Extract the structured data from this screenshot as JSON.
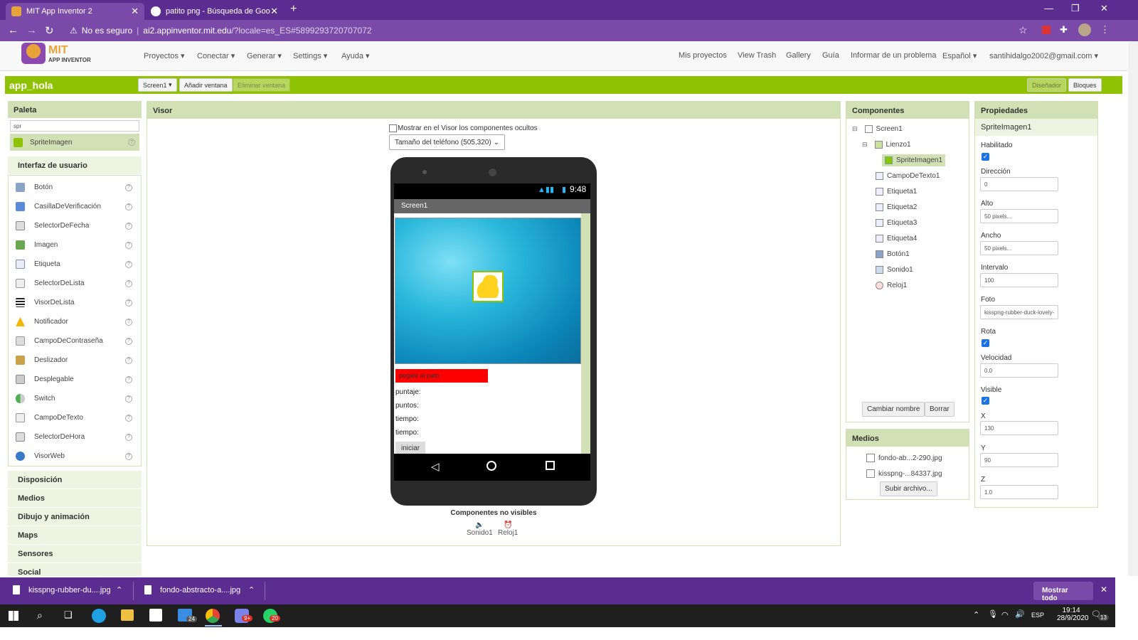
{
  "browser": {
    "tabs": [
      {
        "title": "MIT App Inventor 2"
      },
      {
        "title": "patito png - Búsqueda de Googl"
      }
    ],
    "security": "No es seguro",
    "url_host": "ai2.appinventor.mit.edu",
    "url_path": "/?locale=es_ES#5899293720707072"
  },
  "app_header": {
    "logo_line1": "MIT",
    "logo_line2": "APP INVENTOR",
    "menus": [
      "Proyectos",
      "Conectar",
      "Generar",
      "Settings",
      "Ayuda"
    ],
    "links": [
      "Mis proyectos",
      "View Trash",
      "Gallery",
      "Guía",
      "Informar de un problema"
    ],
    "language": "Español",
    "user": "santihidalgo2002@gmail.com"
  },
  "project_bar": {
    "name": "app_hola",
    "screen_select": "Screen1",
    "add_screen": "Añadir ventana",
    "remove_screen": "Eliminar ventana",
    "designer": "Diseñador",
    "blocks": "Bloques"
  },
  "palette": {
    "title": "Paleta",
    "search_value": "spr",
    "search_result": "SpriteImagen",
    "section_ui": "Interfaz de usuario",
    "items": [
      "Botón",
      "CasillaDeVerificación",
      "SelectorDeFecha",
      "Imagen",
      "Etiqueta",
      "SelectorDeLista",
      "VisorDeLista",
      "Notificador",
      "CampoDeContraseña",
      "Deslizador",
      "Desplegable",
      "Switch",
      "CampoDeTexto",
      "SelectorDeHora",
      "VisorWeb"
    ],
    "drawers": [
      "Disposición",
      "Medios",
      "Dibujo y animación",
      "Maps",
      "Sensores",
      "Social"
    ]
  },
  "viewer": {
    "title": "Visor",
    "show_hidden": "Mostrar en el Visor los componentes ocultos",
    "phone_size": "Tamaño del teléfono (505,320)",
    "clock": "9:48",
    "screen_title": "Screen1",
    "button_red": "pegale al pato",
    "labels": [
      "puntaje:",
      "puntos:",
      "tiempo:",
      "tiempo:"
    ],
    "button_start": "iniciar",
    "nonvisible_title": "Componentes no visibles",
    "nonvisible": [
      "Sonido1",
      "Reloj1"
    ]
  },
  "components": {
    "title": "Componentes",
    "tree": [
      "Screen1",
      "Lienzo1",
      "SpriteImagen1",
      "CampoDeTexto1",
      "Etiqueta1",
      "Etiqueta2",
      "Etiqueta3",
      "Etiqueta4",
      "Botón1",
      "Sonido1",
      "Reloj1"
    ],
    "rename": "Cambiar nombre",
    "delete": "Borrar"
  },
  "media": {
    "title": "Medios",
    "files": [
      "fondo-ab...2-290.jpg",
      "kisspng-...84337.jpg"
    ],
    "upload": "Subir archivo..."
  },
  "properties": {
    "title": "Propiedades",
    "component": "SpriteImagen1",
    "habilitado": "Habilitado",
    "direccion_label": "Dirección",
    "direccion": "0",
    "alto_label": "Alto",
    "alto": "50 pixels...",
    "ancho_label": "Ancho",
    "ancho": "50 pixels...",
    "intervalo_label": "Intervalo",
    "intervalo": "100",
    "foto_label": "Foto",
    "foto": "kisspng-rubber-duck-lovely-",
    "rota": "Rota",
    "velocidad_label": "Velocidad",
    "velocidad": "0.0",
    "visible": "Visible",
    "x_label": "X",
    "x": "130",
    "y_label": "Y",
    "y": "90",
    "z_label": "Z",
    "z": "1.0"
  },
  "downloads": {
    "files": [
      "kisspng-rubber-du....jpg",
      "fondo-abstracto-a....jpg"
    ],
    "show_all": "Mostrar todo"
  },
  "taskbar": {
    "lang": "ESP",
    "time": "19:14",
    "date": "28/9/2020",
    "badge_mail": "24",
    "badge_teams": "9+",
    "badge_whatsapp": "20",
    "notif": "13"
  },
  "colors": {
    "purple": "#5c2d91",
    "green": "#8fc202",
    "panel": "#d2e0b6",
    "red_button": "#ff0000"
  }
}
